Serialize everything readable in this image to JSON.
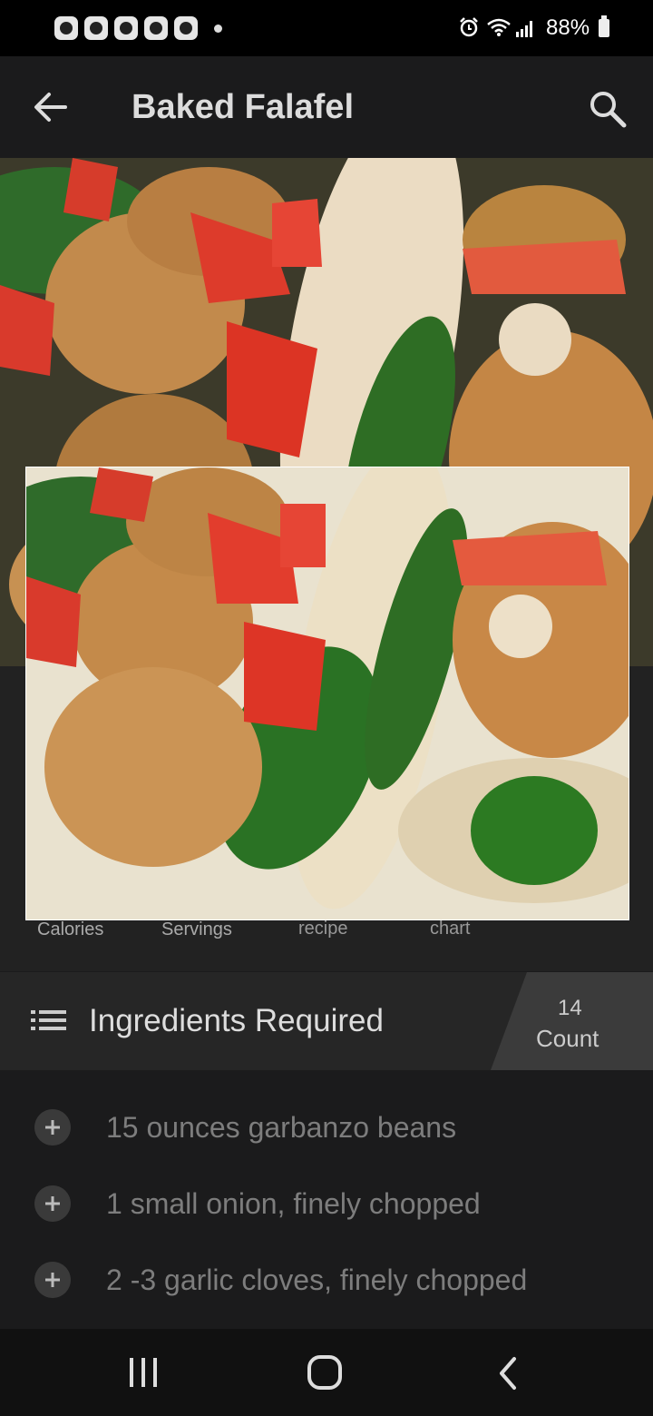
{
  "status_bar": {
    "battery": "88%"
  },
  "app_bar": {
    "title": "Baked Falafel"
  },
  "stats": {
    "calories_label": "Calories",
    "servings_label": "Servings",
    "recipe_label": "recipe",
    "chart_label": "chart"
  },
  "ingredients": {
    "header": "Ingredients Required",
    "count_number": "14",
    "count_label": "Count",
    "items": [
      "15 ounces garbanzo beans",
      "1 small onion, finely chopped",
      "2 -3 garlic cloves, finely chopped"
    ]
  },
  "colors": {
    "background": "#1b1b1c",
    "header": "#262626",
    "count_box": "#3b3b3b"
  }
}
